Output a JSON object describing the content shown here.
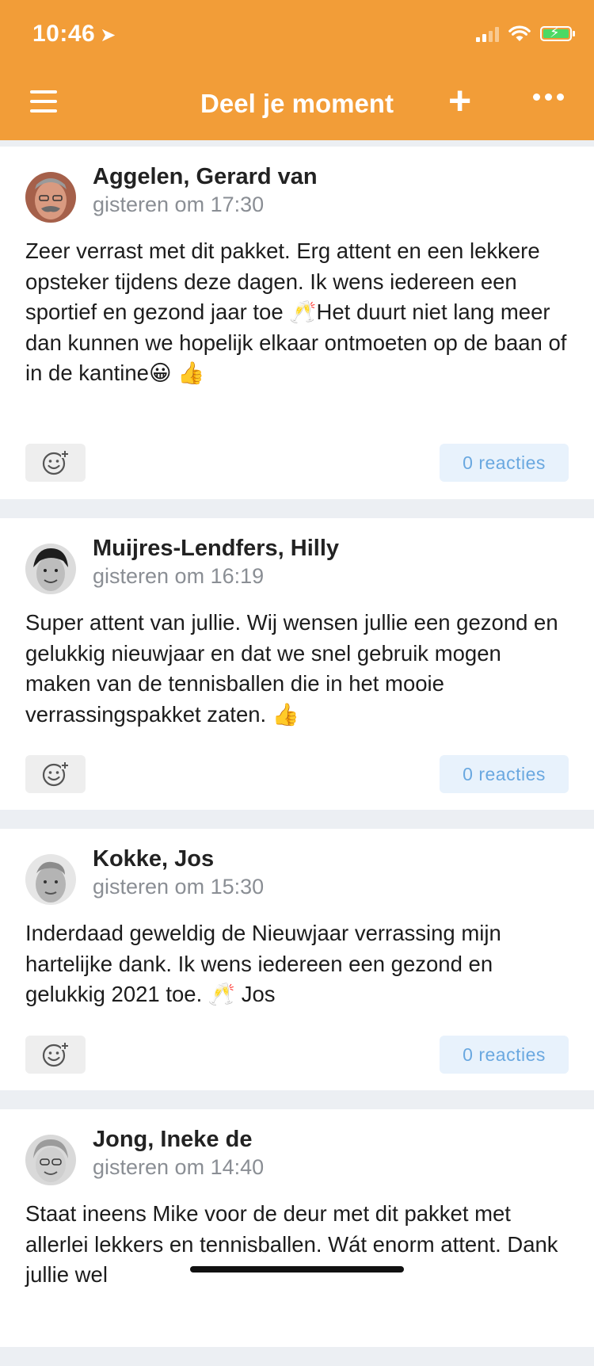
{
  "status_bar": {
    "time": "10:46"
  },
  "nav": {
    "title": "Deel je moment"
  },
  "posts": [
    {
      "author": "Aggelen, Gerard van",
      "time": "gisteren om 17:30",
      "text": "Zeer verrast met dit pakket. Erg attent en een lekkere opsteker tijdens deze dagen. Ik wens iedereen een sportief en gezond jaar toe 🥂Het duurt niet lang meer dan kunnen we hopelijk elkaar ontmoeten op de baan of in de kantine😀 👍",
      "replies": "0 reacties"
    },
    {
      "author": "Muijres-Lendfers, Hilly",
      "time": "gisteren om 16:19",
      "text": "Super attent van jullie. Wij wensen jullie een gezond en gelukkig nieuwjaar en dat we snel gebruik mogen maken van de tennisballen die in het mooie verrassingspakket zaten. 👍",
      "replies": "0 reacties"
    },
    {
      "author": "Kokke, Jos",
      "time": "gisteren om 15:30",
      "text": "Inderdaad geweldig de Nieuwjaar verrassing mijn hartelijke dank. Ik wens iedereen een gezond en gelukkig 2021 toe. 🥂 Jos",
      "replies": "0 reacties"
    },
    {
      "author": "Jong, Ineke de",
      "time": "gisteren om 14:40",
      "text": "Staat ineens Mike voor de deur met dit pakket met allerlei lekkers en tennisballen. Wát enorm attent. Dank jullie wel"
    }
  ]
}
